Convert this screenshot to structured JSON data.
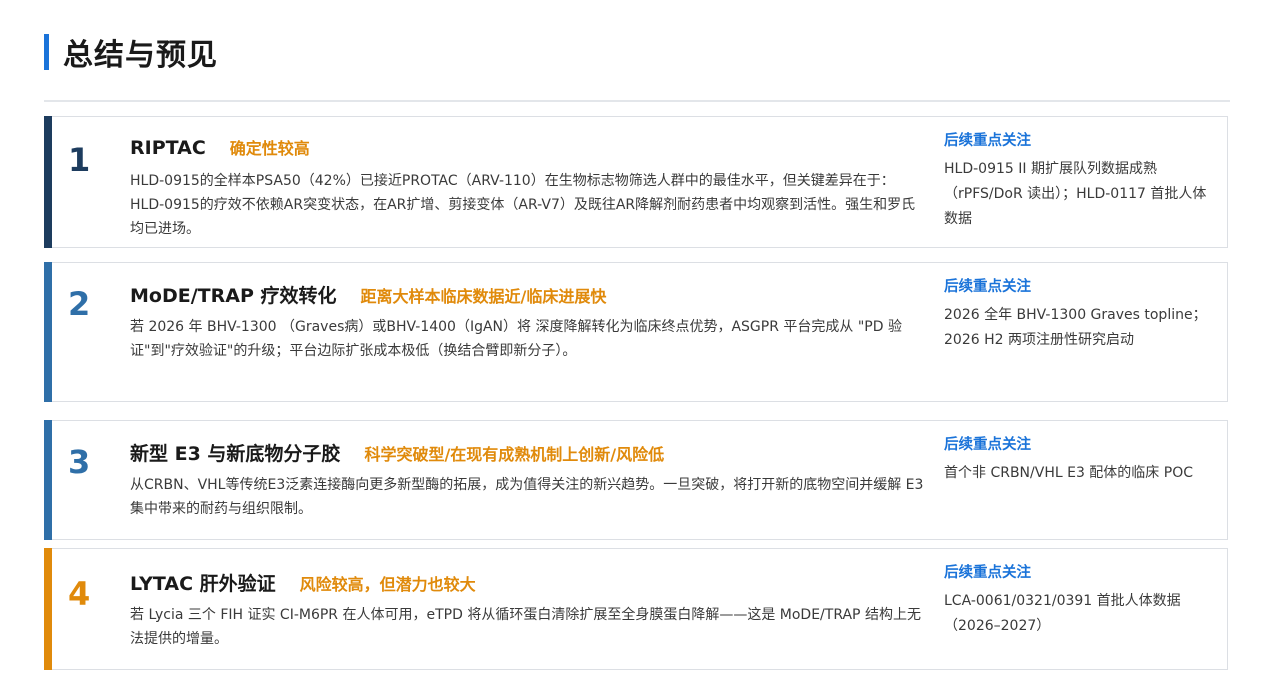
{
  "page": {
    "title": "总结与预见"
  },
  "cards": [
    {
      "number": "1",
      "name": "RIPTAC",
      "tag": "确定性较高",
      "description": "HLD-0915的全样本PSA50（42%）已接近PROTAC（ARV-110）在生物标志物筛选人群中的最佳水平，但关键差异在于：HLD-0915的疗效不依赖AR突变状态，在AR扩增、剪接变体（AR-V7）及既往AR降解剂耐药患者中均观察到活性。强生和罗氏均已进场。",
      "followup_label": "后续重点关注",
      "followup_text": "HLD-0915 II 期扩展队列数据成熟（rPFS/DoR 读出）；HLD-0117 首批人体数据",
      "accent_color": "#1d3c5e",
      "number_color": "#1d3c5e"
    },
    {
      "number": "2",
      "name": "MoDE/TRAP 疗效转化",
      "tag": "距离大样本临床数据近/临床进展快",
      "description": "若 2026 年 BHV-1300 （Graves病）或BHV-1400（IgAN）将 深度降解转化为临床终点优势，ASGPR 平台完成从 \"PD 验证\"到\"疗效验证\"的升级；平台边际扩张成本极低（换结合臂即新分子）。",
      "followup_label": "后续重点关注",
      "followup_text": "2026 全年 BHV-1300 Graves topline；2026 H2 两项注册性研究启动",
      "accent_color": "#2f6fa8",
      "number_color": "#2f6fa8"
    },
    {
      "number": "3",
      "name": "新型 E3 与新底物分子胶",
      "tag": "科学突破型/在现有成熟机制上创新/风险低",
      "description": "从CRBN、VHL等传统E3泛素连接酶向更多新型酶的拓展，成为值得关注的新兴趋势。一旦突破，将打开新的底物空间并缓解 E3 集中带来的耐药与组织限制。",
      "followup_label": "后续重点关注",
      "followup_text": "首个非 CRBN/VHL E3 配体的临床 POC",
      "accent_color": "#2f6fa8",
      "number_color": "#2f6fa8"
    },
    {
      "number": "4",
      "name": "LYTAC 肝外验证",
      "tag": "风险较高，但潜力也较大",
      "description": "若 Lycia 三个 FIH 证实 CI-M6PR 在人体可用，eTPD 将从循环蛋白清除扩展至全身膜蛋白降解——这是 MoDE/TRAP 结构上无法提供的增量。",
      "followup_label": "后续重点关注",
      "followup_text": "LCA-0061/0321/0391 首批人体数据（2026–2027）",
      "accent_color": "#e08a0b",
      "number_color": "#e08a0b"
    }
  ]
}
